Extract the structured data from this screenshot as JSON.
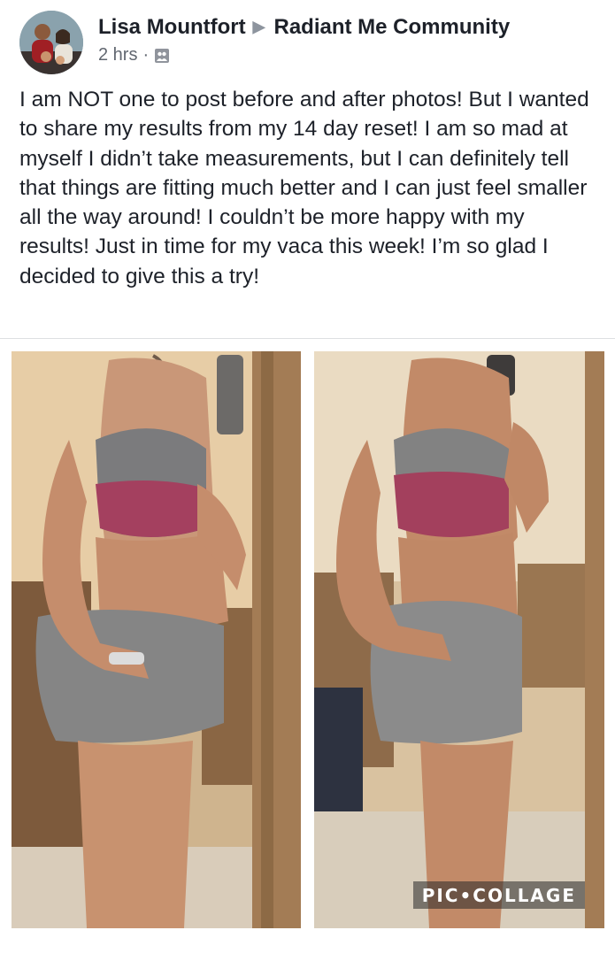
{
  "post": {
    "author": "Lisa Mountfort",
    "group": "Radiant Me Community",
    "time": "2 hrs",
    "separator": "·",
    "audience_icon": "group-icon",
    "text": "I am NOT one to post before and after photos! But I wanted to share my results from my 14 day reset! I am so mad at myself I didn’t take measurements, but I can definitely tell that things are fitting much better and I can just feel smaller all the way around! I couldn’t be more happy with my results! Just in time for my vaca this week! I’m so glad I decided to give this a try!"
  },
  "collage": {
    "watermark": "PIC•COLLAGE"
  },
  "colors": {
    "text": "#1d2129",
    "meta": "#616770",
    "divider": "#dddfe2"
  }
}
